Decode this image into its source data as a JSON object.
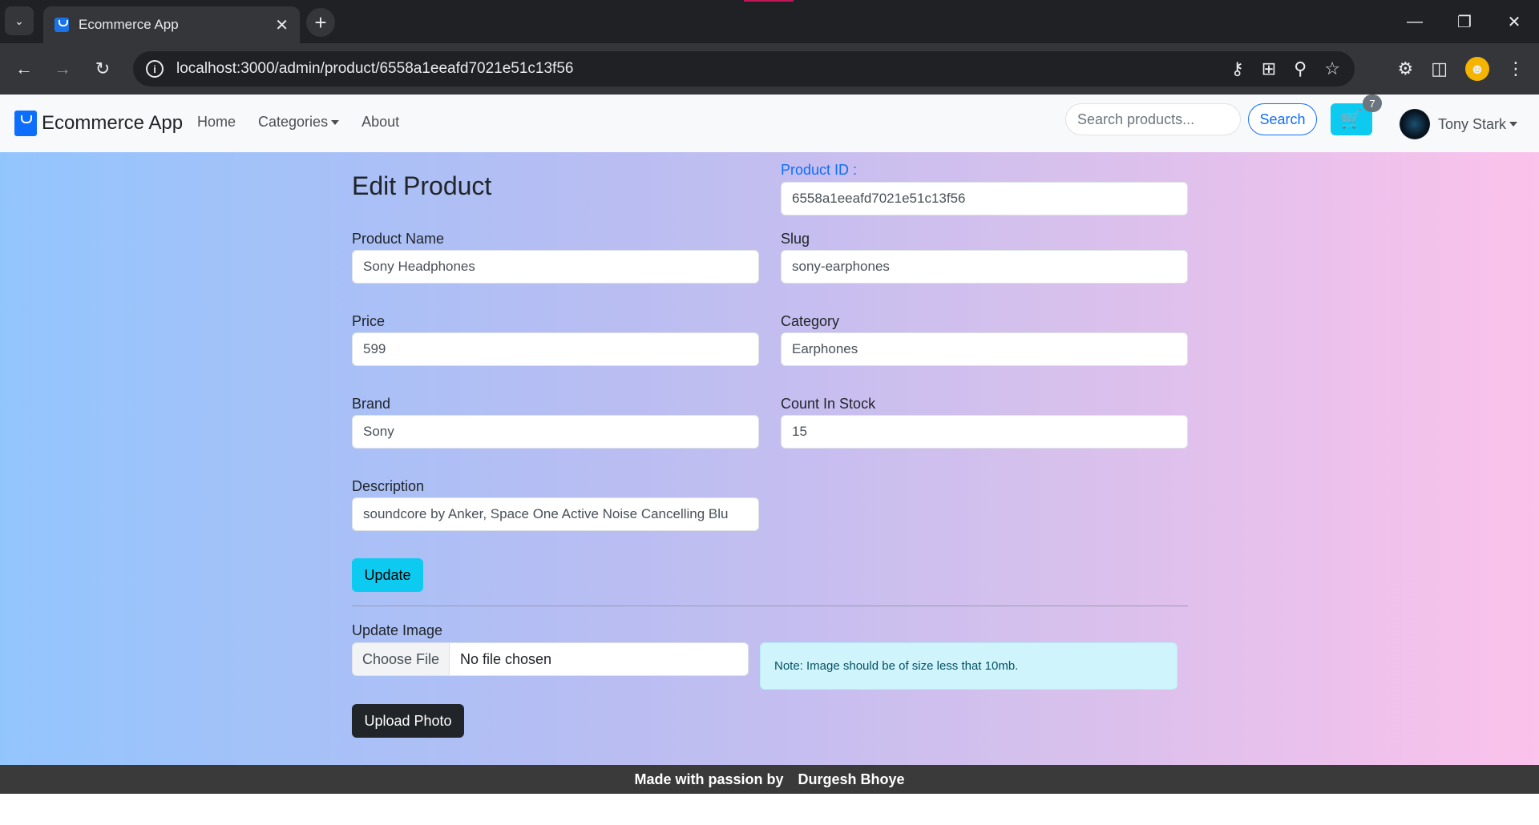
{
  "browser": {
    "tab_title": "Ecommerce App",
    "url": "localhost:3000/admin/product/6558a1eeafd7021e51c13f56"
  },
  "navbar": {
    "brand": "Ecommerce App",
    "links": [
      "Home",
      "Categories",
      "About"
    ],
    "search_placeholder": "Search products...",
    "search_button": "Search",
    "cart_count": "7",
    "user_name": "Tony Stark"
  },
  "form": {
    "title": "Edit Product",
    "product_id_label": "Product ID :",
    "product_id_value": "6558a1eeafd7021e51c13f56",
    "product_name_label": "Product Name",
    "product_name_value": "Sony Headphones",
    "slug_label": "Slug",
    "slug_value": "sony-earphones",
    "price_label": "Price",
    "price_value": "599",
    "category_label": "Category",
    "category_value": "Earphones",
    "brand_label": "Brand",
    "brand_value": "Sony",
    "stock_label": "Count In Stock",
    "stock_value": "15",
    "description_label": "Description",
    "description_value": "soundcore by Anker, Space One Active Noise Cancelling Blu",
    "update_button": "Update"
  },
  "image_upload": {
    "label": "Update Image",
    "choose_file": "Choose File",
    "file_status": "No file chosen",
    "note": "Note: Image should be of size less that 10mb.",
    "upload_button": "Upload Photo"
  },
  "footer": {
    "prefix": "Made with passion by",
    "author": "Durgesh Bhoye"
  }
}
